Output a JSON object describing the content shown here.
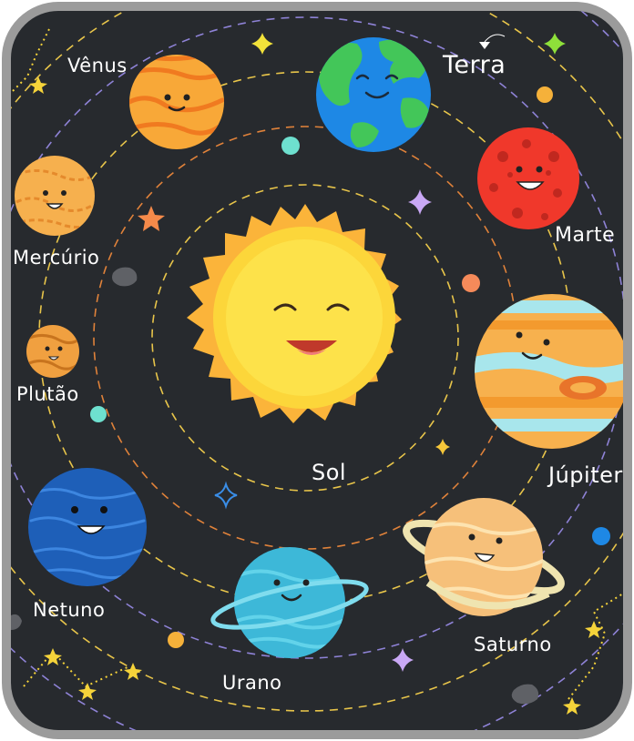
{
  "labels": {
    "venus": "Vênus",
    "earth": "Terra",
    "mars": "Marte",
    "mercury": "Mercúrio",
    "pluto": "Plutão",
    "sun": "Sol",
    "jupiter": "Júpiter",
    "neptune": "Netuno",
    "uranus": "Urano",
    "saturn": "Saturno"
  },
  "colors": {
    "background": "#272a2e",
    "frame": "#9b9b9b",
    "sun": "#fdd835",
    "earth_ocean": "#1e88e5",
    "earth_land": "#43c659",
    "mars": "#f0382b",
    "venus": "#f8a838",
    "neptune": "#1e5fb8",
    "uranus": "#3db8d8",
    "jupiter": "#f7b14e",
    "saturn": "#f6c07a"
  }
}
